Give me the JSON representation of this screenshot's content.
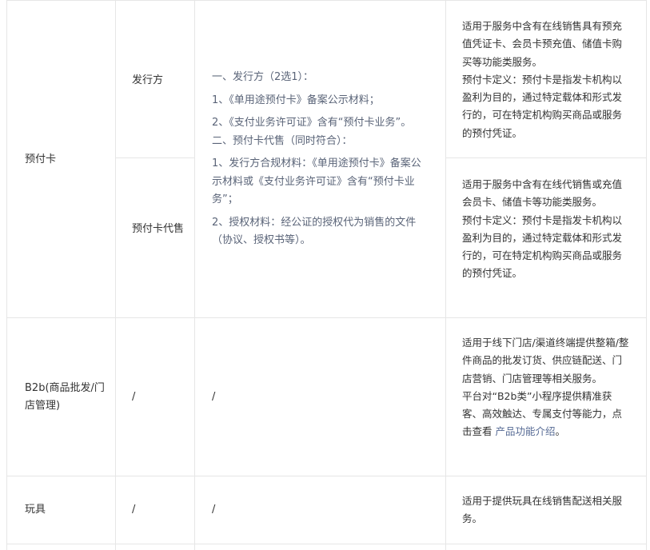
{
  "rows": {
    "prepaid": {
      "category": "预付卡",
      "sub_issuer": "发行方",
      "sub_agent": "预付卡代售",
      "requirements": [
        "一、发行方（2选1）：",
        "1、《单用途预付卡》备案公示材料；",
        "2、《支付业务许可证》含有“预付卡业务”。",
        "二、预付卡代售（同时符合）：",
        "1、发行方合规材料：《单用途预付卡》备案公示材料或《支付业务许可证》含有“预付卡业务”；",
        "2、授权材料：经公证的授权代为销售的文件（协议、授权书等）。"
      ],
      "issuer_desc": [
        "适用于服务中含有在线销售具有预充值凭证卡、会员卡预充值、储值卡购买等功能类服务。",
        "预付卡定义：预付卡是指发卡机构以盈利为目的，通过特定载体和形式发行的，可在特定机构购买商品或服务的预付凭证。"
      ],
      "agent_desc": [
        "适用于服务中含有在线代销售或充值会员卡、储值卡等功能类服务。",
        "预付卡定义：预付卡是指发卡机构以盈利为目的，通过特定载体和形式发行的，可在特定机构购买商品或服务的预付凭证。"
      ]
    },
    "b2b": {
      "category": "B2b(商品批发/门店管理)",
      "sub": "/",
      "requirements": "/",
      "desc_1": "适用于线下门店/渠道终端提供整箱/整件商品的批发订货、供应链配送、门店营销、门店管理等相关服务。",
      "desc_2": "平台对“B2b类”小程序提供精准获客、高效触达、专属支付等能力，点击查看 ",
      "desc_link": "产品功能介绍",
      "desc_end": "。"
    },
    "toy": {
      "category": "玩具",
      "sub": "/",
      "requirements": "/",
      "desc": "适用于提供玩具在线销售配送相关服务。"
    }
  },
  "colors": {
    "border": "#e6e6e6",
    "text": "#333333",
    "requirement_text": "#5a6478",
    "link": "#576b95"
  }
}
